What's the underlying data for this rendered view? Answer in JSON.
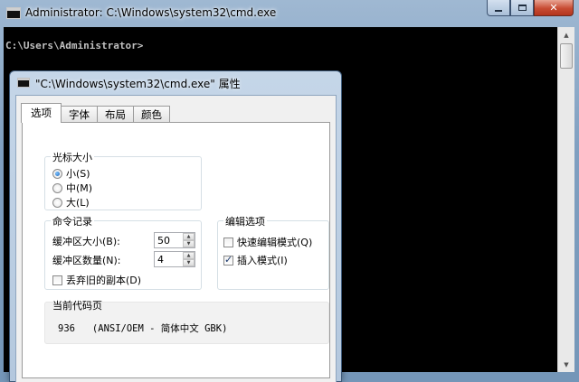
{
  "cmd_window": {
    "title": "Administrator: C:\\Windows\\system32\\cmd.exe",
    "prompt": "C:\\Users\\Administrator>"
  },
  "dialog": {
    "title": "\"C:\\Windows\\system32\\cmd.exe\" 属性",
    "tabs": [
      {
        "label": "选项",
        "active": true
      },
      {
        "label": "字体",
        "active": false
      },
      {
        "label": "布局",
        "active": false
      },
      {
        "label": "颜色",
        "active": false
      }
    ],
    "cursor_size": {
      "label": "光标大小",
      "options": [
        {
          "label": "小(S)",
          "checked": true
        },
        {
          "label": "中(M)",
          "checked": false
        },
        {
          "label": "大(L)",
          "checked": false
        }
      ]
    },
    "command_history": {
      "label": "命令记录",
      "buffer_size_label": "缓冲区大小(B):",
      "buffer_size_value": "50",
      "buffer_count_label": "缓冲区数量(N):",
      "buffer_count_value": "4",
      "discard_label": "丢弃旧的副本(D)",
      "discard_checked": false
    },
    "edit_options": {
      "label": "编辑选项",
      "quick_edit_label": "快速编辑模式(Q)",
      "quick_edit_checked": false,
      "insert_label": "插入模式(I)",
      "insert_checked": true
    },
    "code_page": {
      "label": "当前代码页",
      "value": "936   (ANSI/OEM - 简体中文 GBK)"
    }
  },
  "colors": {
    "console_bg": "#000000",
    "console_text": "#c0c0c0",
    "close_button": "#c74b32"
  }
}
